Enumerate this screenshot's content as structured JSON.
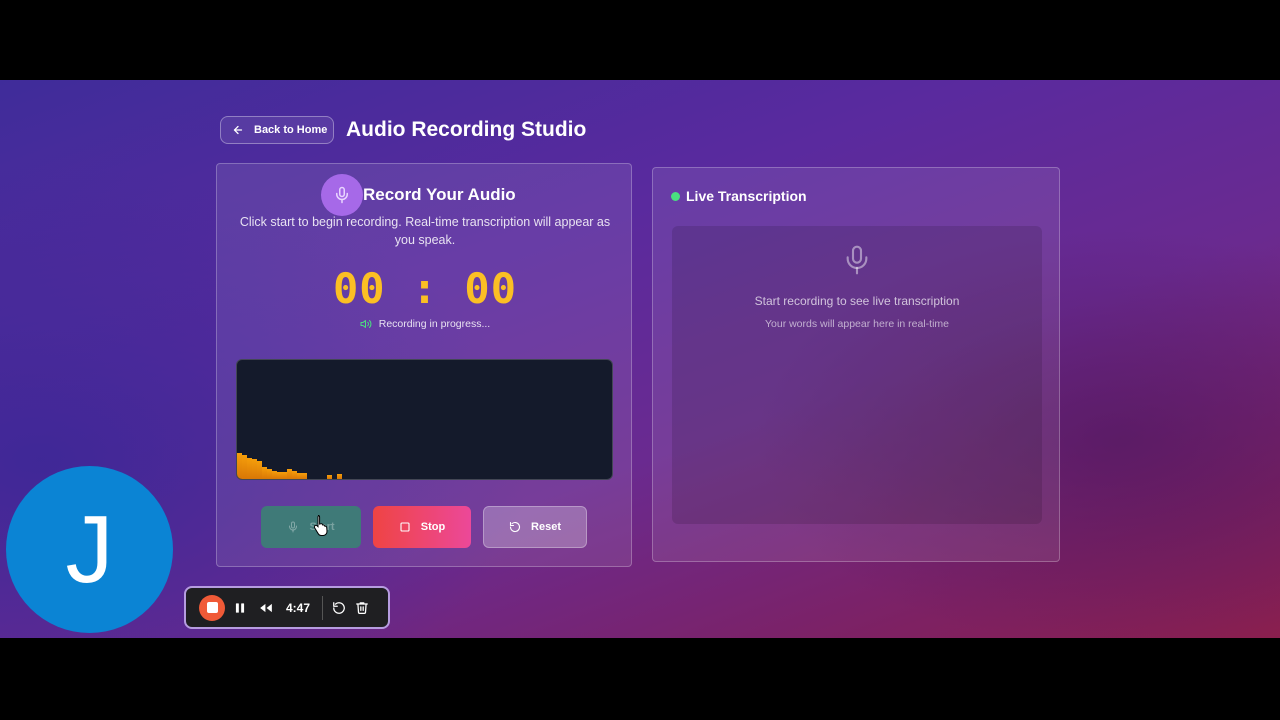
{
  "header": {
    "back_label": "Back to Home",
    "title": "Audio Recording Studio"
  },
  "recorder": {
    "heading": "Record Your Audio",
    "description": "Click start to begin recording. Real-time transcription will appear as you speak.",
    "timer": "00:00",
    "status": "Recording in progress...",
    "visualizer_levels": [
      0.22,
      0.2,
      0.18,
      0.17,
      0.15,
      0.1,
      0.08,
      0.07,
      0.06,
      0.06,
      0.08,
      0.07,
      0.05,
      0.05,
      0.0,
      0.0,
      0.0,
      0.0,
      0.03,
      0.0,
      0.04
    ],
    "buttons": {
      "start": "Start",
      "stop": "Stop",
      "reset": "Reset"
    }
  },
  "transcription": {
    "title": "Live Transcription",
    "empty_title": "Start recording to see live transcription",
    "empty_subtitle": "Your words will appear here in real-time"
  },
  "overlay": {
    "avatar_letter": "J",
    "elapsed": "4:47"
  },
  "colors": {
    "timer": "#fbbf24",
    "live_dot": "#4ade80",
    "stop_gradient_start": "#ef4444",
    "stop_gradient_end": "#ec4899",
    "avatar": "#0b84d4"
  }
}
